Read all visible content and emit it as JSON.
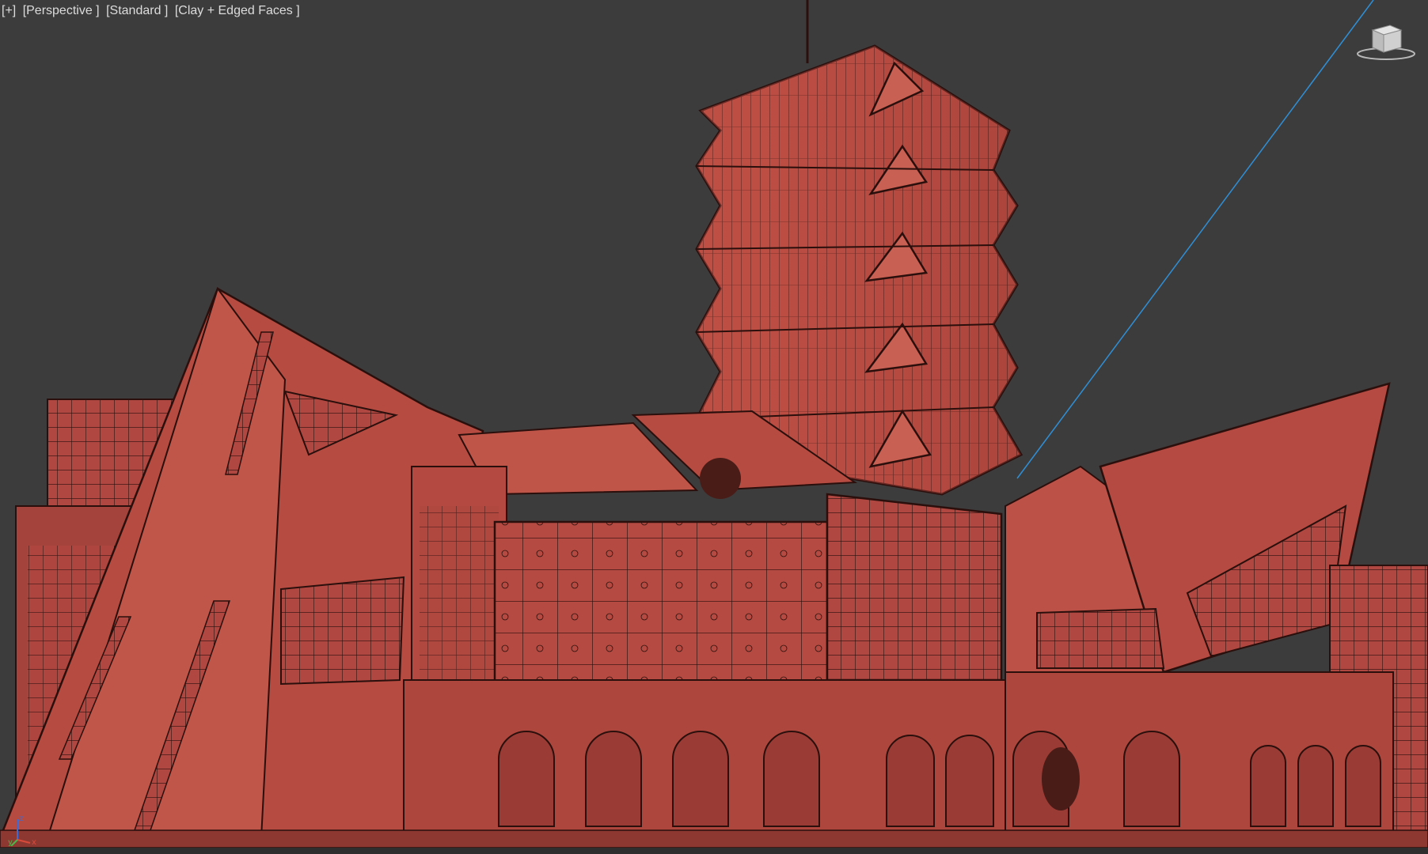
{
  "viewport": {
    "menu_label": "[+]",
    "view_label": "[Perspective ]",
    "shading_label": "[Standard ]",
    "display_label": "[Clay + Edged Faces ]"
  },
  "viewcube": {
    "icon": "viewcube-icon"
  },
  "axis_gizmo": {
    "icon": "axis-tripod-icon",
    "z": "z",
    "x": "x",
    "y": "y"
  },
  "colors": {
    "background": "#3c3c3c",
    "clay": "#b8493f",
    "edges": "#2a0f0c",
    "light_line": "#2f8fd6"
  }
}
